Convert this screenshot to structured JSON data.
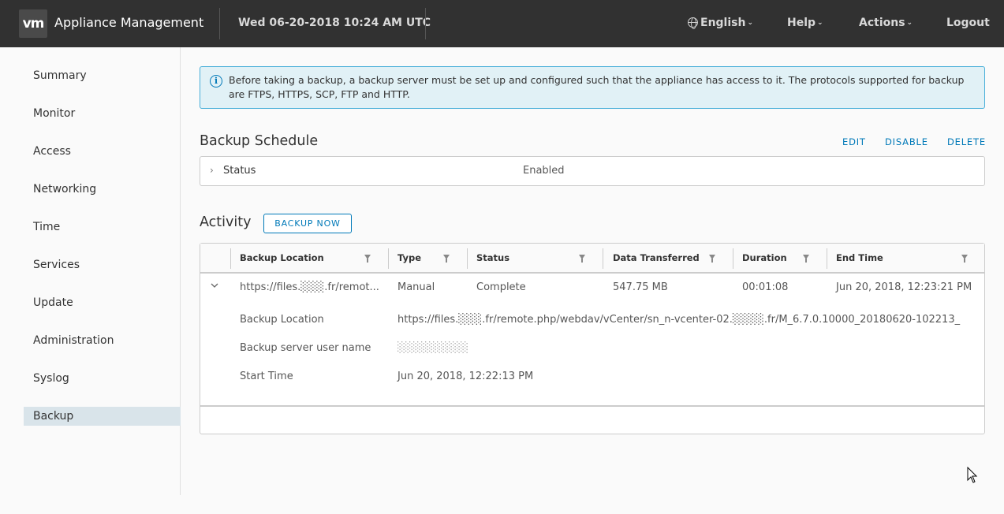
{
  "header": {
    "logo": "vm",
    "title": "Appliance Management",
    "datetime": "Wed 06-20-2018 10:24 AM UTC",
    "menu": {
      "language": "English",
      "help": "Help",
      "actions": "Actions",
      "logout": "Logout"
    }
  },
  "sidebar": {
    "items": [
      {
        "label": "Summary"
      },
      {
        "label": "Monitor"
      },
      {
        "label": "Access"
      },
      {
        "label": "Networking"
      },
      {
        "label": "Time"
      },
      {
        "label": "Services"
      },
      {
        "label": "Update"
      },
      {
        "label": "Administration"
      },
      {
        "label": "Syslog"
      },
      {
        "label": "Backup",
        "active": true
      }
    ]
  },
  "alert": {
    "text": "Before taking a backup, a backup server must be set up and configured such that the appliance has access to it. The protocols supported for backup are FTPS, HTTPS, SCP, FTP and HTTP."
  },
  "schedule": {
    "title": "Backup Schedule",
    "actions": {
      "edit": "EDIT",
      "disable": "DISABLE",
      "delete": "DELETE"
    },
    "status_label": "Status",
    "status_value": "Enabled"
  },
  "activity": {
    "title": "Activity",
    "backup_now": "BACKUP NOW",
    "columns": [
      "Backup Location",
      "Type",
      "Status",
      "Data Transferred",
      "Duration",
      "End Time"
    ],
    "row": {
      "location": "https://files.░░░.fr/remot...",
      "type": "Manual",
      "status": "Complete",
      "data_transferred": "547.75 MB",
      "duration": "00:01:08",
      "end_time": "Jun 20, 2018, 12:23:21 PM"
    },
    "details": {
      "location_label": "Backup Location",
      "location_value": "https://files.░░░.fr/remote.php/webdav/vCenter/sn_n-vcenter-02.░░░░.fr/M_6.7.0.10000_20180620-102213_",
      "user_label": "Backup server user name",
      "user_value": "░░░░░░░░░",
      "start_label": "Start Time",
      "start_value": "Jun 20, 2018, 12:22:13 PM"
    }
  },
  "colors": {
    "header_bg": "#313131",
    "accent": "#0079b8",
    "alert_bg": "#e1f1f6",
    "active_nav": "#d9e4ea"
  }
}
